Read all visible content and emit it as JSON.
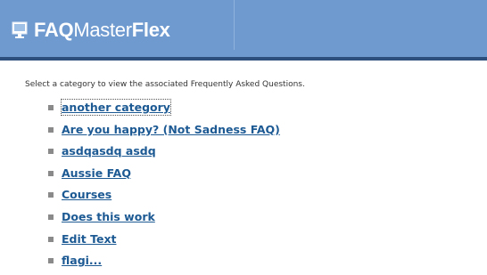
{
  "header": {
    "logo_part1": "FAQ",
    "logo_part2": "Master",
    "logo_part3": "Flex",
    "logo_icon": "computer-monitor-icon",
    "colors": {
      "header_bg": "#6f9ad0",
      "header_bottom": "#2d4f7e",
      "link": "#1d5a94"
    }
  },
  "main": {
    "intro_text": "Select a category to view the associated Frequently Asked Questions.",
    "categories": [
      {
        "label": "another category"
      },
      {
        "label": "Are you happy? (Not Sadness FAQ)"
      },
      {
        "label": "asdqasdq asdq"
      },
      {
        "label": "Aussie FAQ"
      },
      {
        "label": "Courses"
      },
      {
        "label": "Does this work"
      },
      {
        "label": "Edit Text"
      },
      {
        "label": "flagi..."
      }
    ]
  }
}
